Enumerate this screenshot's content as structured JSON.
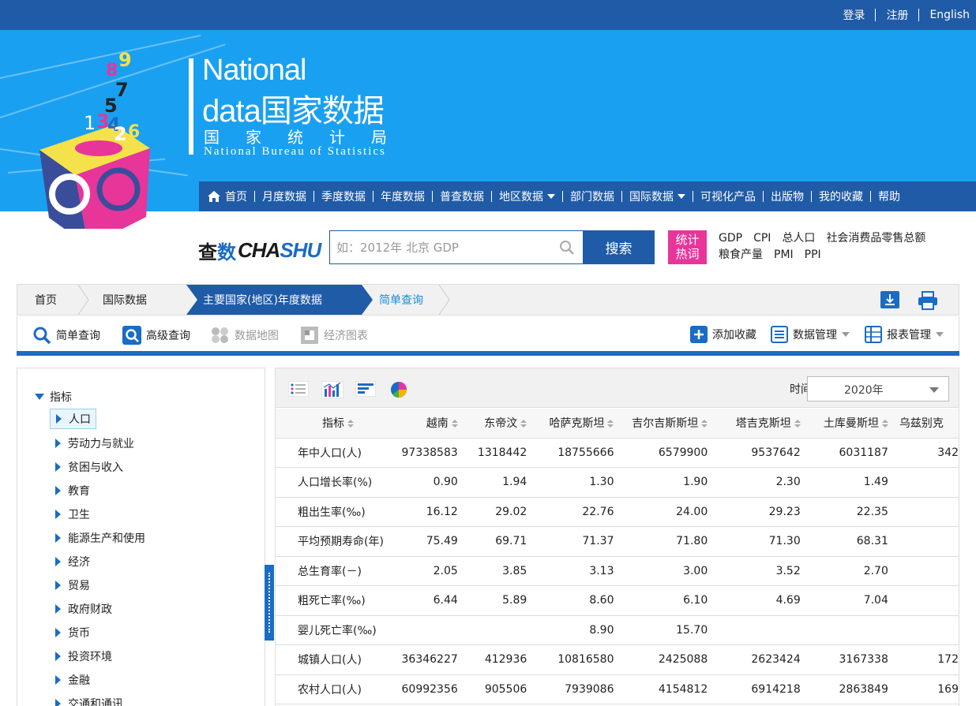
{
  "top_links": [
    "登录",
    "注册",
    "English"
  ],
  "logo": {
    "line1": "National",
    "line2": "data国家数据",
    "line3": "国家统计局",
    "line4": "National Bureau of Statistics"
  },
  "nav": [
    {
      "label": "首页",
      "icon": "home-icon"
    },
    {
      "label": "月度数据"
    },
    {
      "label": "季度数据"
    },
    {
      "label": "年度数据"
    },
    {
      "label": "普查数据"
    },
    {
      "label": "地区数据",
      "dropdown": true
    },
    {
      "label": "部门数据"
    },
    {
      "label": "国际数据",
      "dropdown": true
    },
    {
      "label": "可视化产品"
    },
    {
      "label": "出版物"
    },
    {
      "label": "我的收藏"
    },
    {
      "label": "帮助"
    }
  ],
  "search": {
    "logo_cn_1": "查",
    "logo_cn_2": "数",
    "logo_en_1": "CHA",
    "logo_en_2": "SHU",
    "placeholder": "如：2012年 北京 GDP",
    "button": "搜索",
    "hot_badge_1": "统计",
    "hot_badge_2": "热词",
    "hot_row1": [
      "GDP",
      "CPI",
      "总人口",
      "社会消费品零售总额"
    ],
    "hot_row2": [
      "粮食产量",
      "PMI",
      "PPI"
    ]
  },
  "breadcrumb": [
    "首页",
    "国际数据",
    "主要国家(地区)年度数据",
    "简单查询"
  ],
  "toolbar": {
    "simple_query": "简单查询",
    "advanced_query": "高级查询",
    "data_map": "数据地图",
    "econ_chart": "经济图表",
    "add_favorite": "添加收藏",
    "data_manage": "数据管理",
    "report_manage": "报表管理"
  },
  "tree": {
    "root": "指标",
    "items": [
      "人口",
      "劳动力与就业",
      "贫困与收入",
      "教育",
      "卫生",
      "能源生产和使用",
      "经济",
      "贸易",
      "政府财政",
      "货币",
      "投资环境",
      "金融",
      "交通和通讯"
    ]
  },
  "panel": {
    "time_label": "时间：",
    "time_value": "2020年"
  },
  "table": {
    "headers": [
      "指标",
      "越南",
      "东帝汶",
      "哈萨克斯坦",
      "吉尔吉斯斯坦",
      "塔吉克斯坦",
      "土库曼斯坦",
      "乌兹别克"
    ],
    "rows": [
      [
        "年中人口(人)",
        "97338583",
        "1318442",
        "18755666",
        "6579900",
        "9537642",
        "6031187",
        "342"
      ],
      [
        "人口增长率(%)",
        "0.90",
        "1.94",
        "1.30",
        "1.90",
        "2.30",
        "1.49",
        ""
      ],
      [
        "粗出生率(‰)",
        "16.12",
        "29.02",
        "22.76",
        "24.00",
        "29.23",
        "22.35",
        ""
      ],
      [
        "平均预期寿命(年)",
        "75.49",
        "69.71",
        "71.37",
        "71.80",
        "71.30",
        "68.31",
        ""
      ],
      [
        "总生育率(－)",
        "2.05",
        "3.85",
        "3.13",
        "3.00",
        "3.52",
        "2.70",
        ""
      ],
      [
        "粗死亡率(‰)",
        "6.44",
        "5.89",
        "8.60",
        "6.10",
        "4.69",
        "7.04",
        ""
      ],
      [
        "婴儿死亡率(‰)",
        "",
        "",
        "8.90",
        "15.70",
        "",
        "",
        ""
      ],
      [
        "城镇人口(人)",
        "36346227",
        "412936",
        "10816580",
        "2425088",
        "2623424",
        "3167338",
        "172"
      ],
      [
        "农村人口(人)",
        "60992356",
        "905506",
        "7939086",
        "4154812",
        "6914218",
        "2863849",
        "169"
      ]
    ]
  },
  "colors": {
    "primary_blue": "#1f5ba7",
    "banner_blue": "#1aa0f0",
    "accent_blue": "#1a6cc4",
    "hot_pink": "#e8359a"
  }
}
